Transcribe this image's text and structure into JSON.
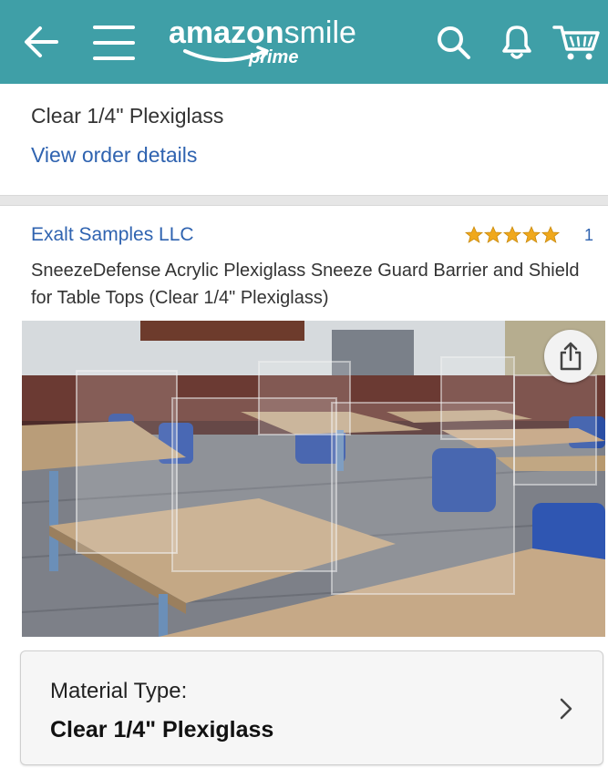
{
  "header": {
    "brand": "amazon",
    "brand_suffix": "smile",
    "prime_label": "prime",
    "icons": [
      "back-arrow-icon",
      "menu-icon",
      "search-icon",
      "bell-icon",
      "cart-icon"
    ],
    "background_color": "#3f9fa7"
  },
  "order": {
    "material_text": "Clear 1/4\" Plexiglass",
    "view_details_label": "View order details"
  },
  "product": {
    "seller": "Exalt Samples LLC",
    "rating_stars": 5,
    "rating_count": "1",
    "title": "SneezeDefense Acrylic Plexiglass Sneeze Guard Barrier and Shield for Table Tops (Clear 1/4\" Plexiglass)",
    "image_icon": "share-icon",
    "variant": {
      "label": "Material Type:",
      "value": "Clear 1/4\" Plexiglass",
      "icon": "chevron-right-icon"
    }
  },
  "colors": {
    "link": "#2f63b0",
    "star": "#f0a81c"
  }
}
